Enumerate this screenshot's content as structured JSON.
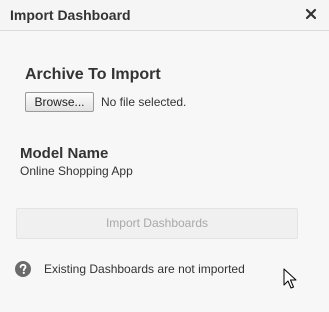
{
  "dialog": {
    "title": "Import Dashboard",
    "close_icon": "close-icon"
  },
  "archive": {
    "heading": "Archive To Import",
    "browse_label": "Browse...",
    "file_status": "No file selected."
  },
  "model": {
    "heading": "Model Name",
    "value": "Online Shopping App"
  },
  "import_button": {
    "label": "Import Dashboards",
    "enabled": false
  },
  "note": {
    "icon": "help-icon",
    "text": "Existing Dashboards are not imported"
  },
  "colors": {
    "background": "#f7f7f7",
    "title_text": "#333333",
    "disabled_text": "#a8a8a8",
    "help_icon": "#6b6b6b"
  }
}
